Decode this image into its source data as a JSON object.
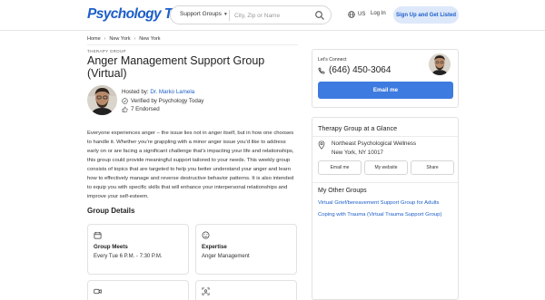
{
  "header": {
    "logo": "Psychology Today",
    "search_type": "Support Groups",
    "search_placeholder": "City, Zip or Name",
    "lang": "US",
    "login": "Log In",
    "signup": "Sign Up and Get Listed"
  },
  "breadcrumb": [
    "Home",
    "New York",
    "New York"
  ],
  "group": {
    "eyebrow": "THERAPY GROUP",
    "title": "Anger Management Support Group (Virtual)",
    "hosted_by_prefix": "Hosted by: ",
    "host_name": "Dr. Marko Lamela",
    "verified": "Verified by Psychology Today",
    "endorsed": "7 Endorsed",
    "description": "Everyone experiences anger – the issue lies not in anger itself, but in how one chooses to handle it. Whether you’re grappling with a minor anger issue you’d like to address early on or are facing a significant challenge that’s impacting your life and relationships, this group could provide meaningful support tailored to your needs. This weekly group consists of topics that are targeted to help you better understand your anger and learn how to effectively manage and reverse destructive behavior patterns. It is also intended to equip you with specific skills that will enhance your interpersonal relationships and improve your self-esteem."
  },
  "details": {
    "title": "Group Details",
    "meets_label": "Group Meets",
    "meets_value": "Every Tue 6 P.M. - 7:30 P.M.",
    "expertise_label": "Expertise",
    "expertise_value": "Anger Management"
  },
  "connect": {
    "label": "Let's Connect",
    "phone": "(646) 450-3064",
    "email_button": "Email me"
  },
  "glance": {
    "title": "Therapy Group at a Glance",
    "org_name": "Northeast Psychological Wellness",
    "org_location": "New York, NY 10017",
    "buttons": [
      "Email me",
      "My website",
      "Share"
    ]
  },
  "other_groups": {
    "title": "My Other Groups",
    "links": [
      "Virtual Grief/bereavement Support Group for Adults",
      "Coping with Trauma (Virtual Trauma Support Group)"
    ]
  },
  "colors": {
    "brand_blue": "#1d5fc9",
    "button_blue": "#3e7be0",
    "signup_bg": "#dde8fa"
  }
}
